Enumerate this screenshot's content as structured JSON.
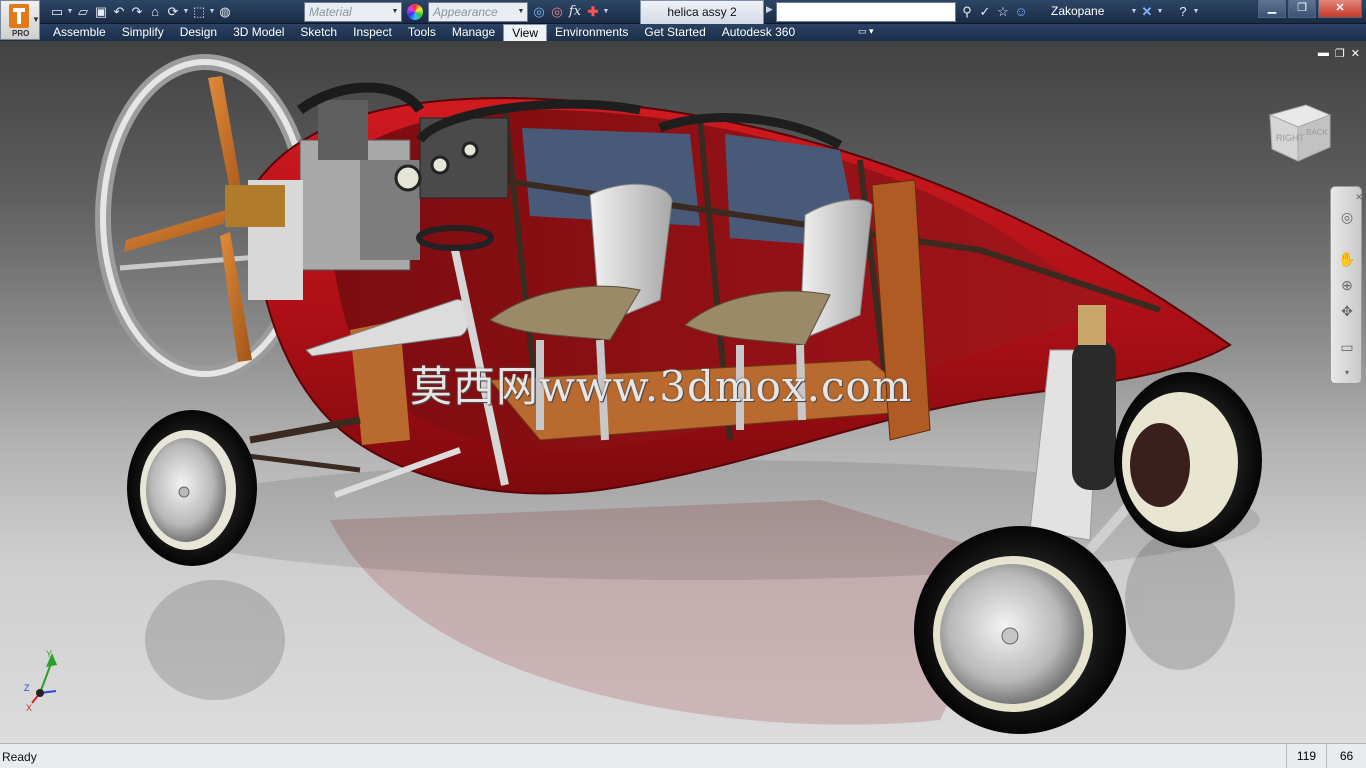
{
  "app": {
    "edition": "PRO"
  },
  "quick_access": {
    "material_placeholder": "Material",
    "appearance_placeholder": "Appearance",
    "fx_label": "fx"
  },
  "document_tab": "helica assy 2",
  "user": {
    "name": "Zakopane"
  },
  "menu": {
    "tabs": [
      "Assemble",
      "Simplify",
      "Design",
      "3D Model",
      "Sketch",
      "Inspect",
      "Tools",
      "Manage",
      "View",
      "Environments",
      "Get Started",
      "Autodesk 360"
    ],
    "active": "View"
  },
  "viewport": {
    "watermark": "莫西网www.3dmox.com",
    "viewcube": {
      "face_right": "RIGHT",
      "face_back": "BACK"
    },
    "triad": {
      "x": "X",
      "y": "Y",
      "z": "Z"
    }
  },
  "status": {
    "text": "Ready",
    "value1": "119",
    "value2": "66"
  },
  "colors": {
    "titlebar": "#1f3352",
    "body_red": "#b5121a",
    "accent_orange": "#e07a1a"
  }
}
